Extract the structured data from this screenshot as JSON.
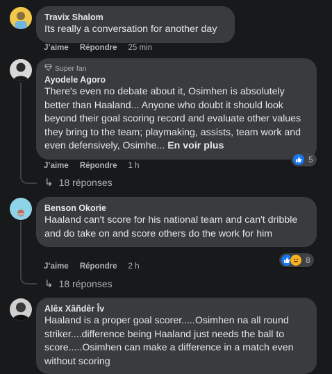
{
  "comments": [
    {
      "author": "Travix Shalom",
      "text": "Its really a conversation for another day",
      "like_label": "J’aime",
      "reply_label": "Répondre",
      "time": "25 min"
    },
    {
      "badge": "Super fan",
      "author": "Ayodele Agoro",
      "text": "There's even no debate about it, Osimhen is absolutely better than Haaland... Anyone who doubt it should look beyond their goal scoring record and evaluate other values they bring to the team; playmaking, assists, team work and even defensively, Osimhe...",
      "see_more": "En voir plus",
      "like_label": "J’aime",
      "reply_label": "Répondre",
      "time": "1 h",
      "reaction_count": "5",
      "replies_label": "18 réponses"
    },
    {
      "author": "Benson Okorie",
      "text": "Haaland can't score for his national team and can't dribble and do take on and score others do the work for him",
      "like_label": "J’aime",
      "reply_label": "Répondre",
      "time": "2 h",
      "reaction_count": "8",
      "replies_label": "18 réponses"
    },
    {
      "author": "Alêx Xâñdêr Îv",
      "text": "Haaland is a proper goal scorer.....Osimhen na all round striker....difference being Haaland just needs the ball to score.....Osimhen can make a difference in a match even without scoring"
    }
  ],
  "colors": {
    "background": "#18191a",
    "bubble": "#3a3b3c",
    "like_blue": "#1877f2",
    "haha_yellow": "#f7b125"
  }
}
